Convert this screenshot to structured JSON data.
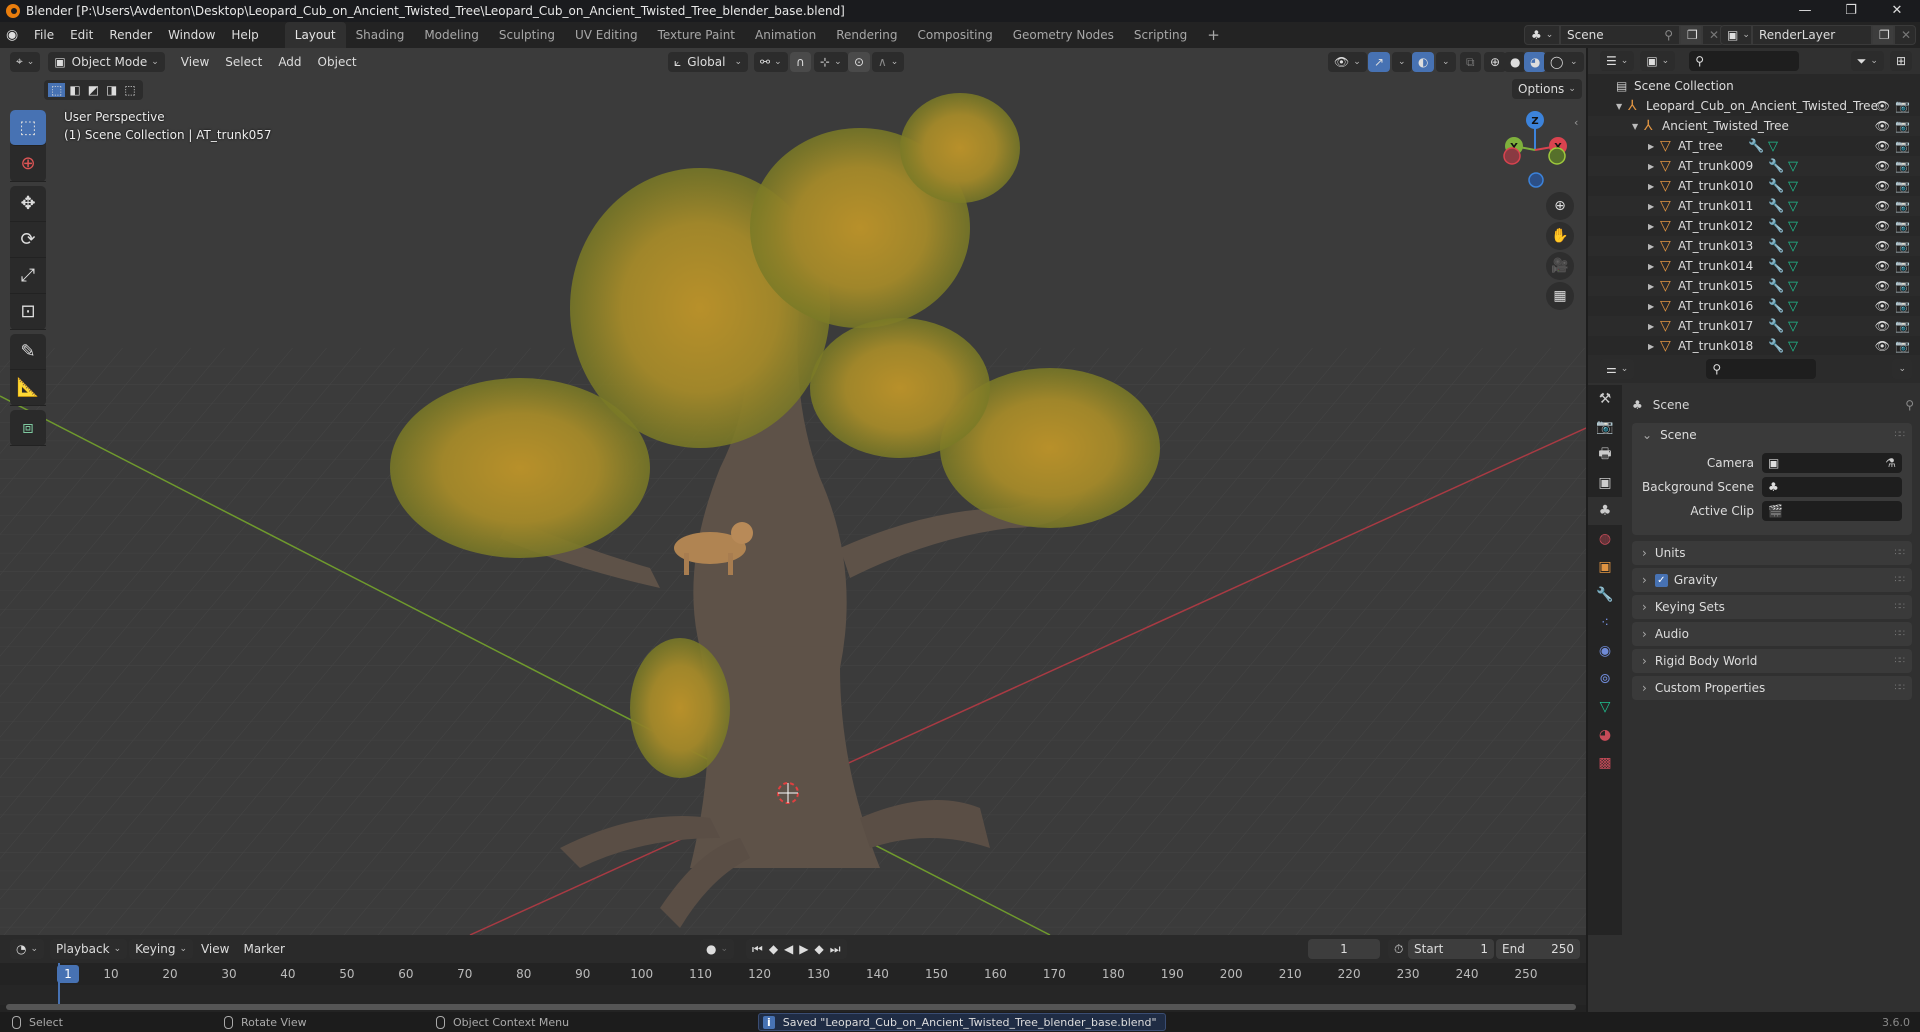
{
  "window": {
    "title": "Blender [P:\\Users\\Avdenton\\Desktop\\Leopard_Cub_on_Ancient_Twisted_Tree\\Leopard_Cub_on_Ancient_Twisted_Tree_blender_base.blend]",
    "minimize": "—",
    "maximize": "❐",
    "close": "✕"
  },
  "menu": [
    "File",
    "Edit",
    "Render",
    "Window",
    "Help"
  ],
  "workspaces": [
    {
      "label": "Layout",
      "active": true
    },
    {
      "label": "Shading"
    },
    {
      "label": "Modeling"
    },
    {
      "label": "Sculpting"
    },
    {
      "label": "UV Editing"
    },
    {
      "label": "Texture Paint"
    },
    {
      "label": "Animation"
    },
    {
      "label": "Rendering"
    },
    {
      "label": "Compositing"
    },
    {
      "label": "Geometry Nodes"
    },
    {
      "label": "Scripting"
    }
  ],
  "add_workspace": "+",
  "scene_selector": {
    "value": "Scene"
  },
  "view_layer_selector": {
    "value": "RenderLayer"
  },
  "viewport": {
    "mode": "Object Mode",
    "menus": [
      "View",
      "Select",
      "Add",
      "Object"
    ],
    "transform_orientation": "Global",
    "options_label": "Options",
    "perspective_label": "User Perspective",
    "active_info": "(1) Scene Collection | AT_trunk057",
    "gizmo_axes": {
      "z": "Z",
      "y": "Y",
      "x": "X"
    },
    "tools": [
      "select-box",
      "cursor",
      "move",
      "rotate",
      "scale",
      "transform",
      "annotate",
      "measure",
      "add-cube"
    ],
    "active_tool": "select-box"
  },
  "outliner": {
    "root": "Scene Collection",
    "items": [
      {
        "name": "Leopard_Cub_on_Ancient_Twisted_Tree",
        "type": "collection",
        "level": 1,
        "expanded": true
      },
      {
        "name": "Ancient_Twisted_Tree",
        "type": "collection",
        "level": 2,
        "expanded": true
      },
      {
        "name": "AT_tree",
        "type": "object",
        "level": 3
      },
      {
        "name": "AT_trunk009",
        "type": "object",
        "level": 3
      },
      {
        "name": "AT_trunk010",
        "type": "object",
        "level": 3
      },
      {
        "name": "AT_trunk011",
        "type": "object",
        "level": 3
      },
      {
        "name": "AT_trunk012",
        "type": "object",
        "level": 3
      },
      {
        "name": "AT_trunk013",
        "type": "object",
        "level": 3
      },
      {
        "name": "AT_trunk014",
        "type": "object",
        "level": 3
      },
      {
        "name": "AT_trunk015",
        "type": "object",
        "level": 3
      },
      {
        "name": "AT_trunk016",
        "type": "object",
        "level": 3
      },
      {
        "name": "AT_trunk017",
        "type": "object",
        "level": 3
      },
      {
        "name": "AT_trunk018",
        "type": "object",
        "level": 3
      }
    ]
  },
  "properties": {
    "context_title": "Scene",
    "scene_panel": {
      "title": "Scene",
      "fields": [
        {
          "label": "Camera",
          "value": ""
        },
        {
          "label": "Background Scene",
          "value": ""
        },
        {
          "label": "Active Clip",
          "value": ""
        }
      ]
    },
    "collapsed_panels": [
      {
        "title": "Units"
      },
      {
        "title": "Gravity",
        "checkbox": true
      },
      {
        "title": "Keying Sets"
      },
      {
        "title": "Audio"
      },
      {
        "title": "Rigid Body World"
      },
      {
        "title": "Custom Properties"
      }
    ]
  },
  "timeline": {
    "menus": [
      "Playback",
      "Keying",
      "View",
      "Marker"
    ],
    "current_frame": "1",
    "start_label": "Start",
    "start": "1",
    "end_label": "End",
    "end": "250",
    "ticks": [
      "10",
      "20",
      "30",
      "40",
      "50",
      "60",
      "70",
      "80",
      "90",
      "100",
      "110",
      "120",
      "130",
      "140",
      "150",
      "160",
      "170",
      "180",
      "190",
      "200",
      "210",
      "220",
      "230",
      "240",
      "250"
    ]
  },
  "statusbar": {
    "select": "Select",
    "rotate": "Rotate View",
    "context": "Object Context Menu",
    "message": "Saved \"Leopard_Cub_on_Ancient_Twisted_Tree_blender_base.blend\"",
    "version": "3.6.0"
  },
  "colors": {
    "accent": "#4772b3",
    "object_orange": "#e09442",
    "modifier_blue": "#6f8ad6",
    "mesh_green": "#1fbf8f",
    "axis_x": "#d9434f",
    "axis_y": "#7eb03c",
    "axis_z": "#3c83db"
  }
}
